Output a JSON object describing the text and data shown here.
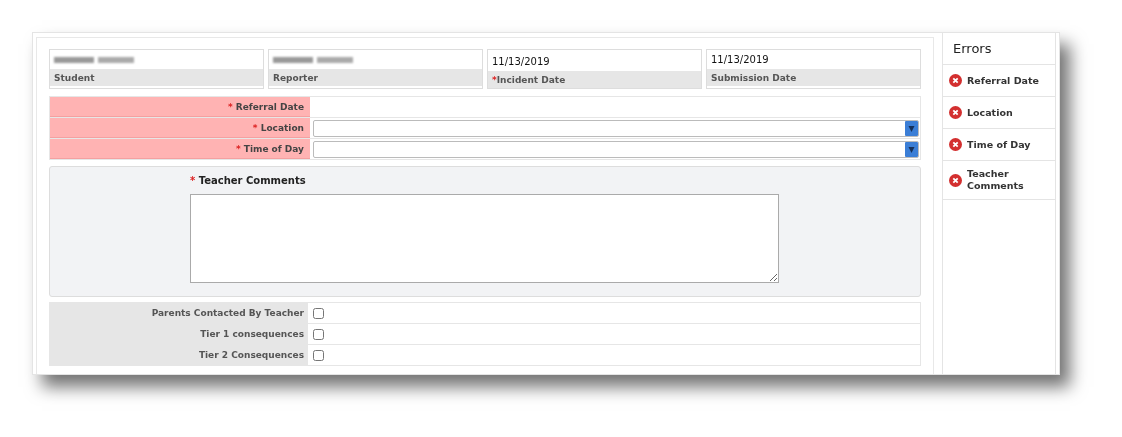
{
  "header_fields": [
    {
      "label": "Student",
      "kind": "blurred"
    },
    {
      "label": "Reporter",
      "kind": "blurred"
    },
    {
      "label": "Incident Date",
      "kind": "text",
      "value": "11/13/2019",
      "required_mark": "*"
    },
    {
      "label": "Submission Date",
      "kind": "text",
      "value": "11/13/2019"
    }
  ],
  "form_rows": [
    {
      "label": "Referral Date",
      "required_mark": "*",
      "error": true,
      "kind": "blank"
    },
    {
      "label": "Location",
      "required_mark": "*",
      "error": true,
      "kind": "select"
    },
    {
      "label": "Time of Day",
      "required_mark": "*",
      "error": true,
      "kind": "select"
    }
  ],
  "comments": {
    "label": "Teacher Comments",
    "required_mark": "*"
  },
  "checkbox_rows": [
    {
      "label": "Parents Contacted By Teacher",
      "checked": false
    },
    {
      "label": "Tier 1 consequences",
      "checked": false
    },
    {
      "label": "Tier 2 Consequences",
      "checked": false
    }
  ],
  "errors": {
    "title": "Errors",
    "items": [
      "Referral Date",
      "Location",
      "Time of Day",
      "Teacher Comments"
    ]
  }
}
